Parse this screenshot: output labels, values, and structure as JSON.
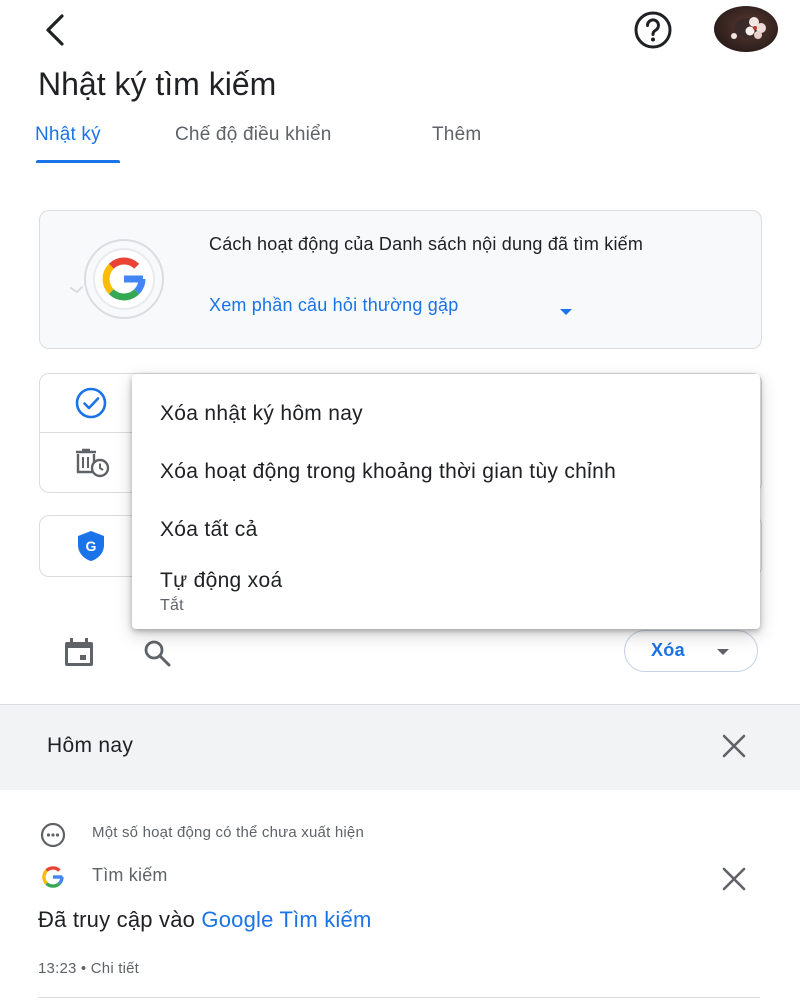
{
  "header": {
    "title": "Nhật ký tìm kiếm",
    "back_icon": "arrow-back-icon",
    "help_icon": "help-icon"
  },
  "tabs": [
    {
      "label": "Nhật ký",
      "active": true
    },
    {
      "label": "Chế độ điều khiển",
      "active": false
    },
    {
      "label": "Thêm",
      "active": false
    }
  ],
  "info_card": {
    "title": "Cách hoạt động của Danh sách nội dung đã tìm kiếm",
    "link": "Xem phần câu hỏi thường gặp"
  },
  "menu": {
    "items": [
      {
        "label": "Xóa nhật ký hôm nay"
      },
      {
        "label": "Xóa hoạt động trong khoảng thời gian tùy chỉnh"
      },
      {
        "label": "Xóa tất cả"
      },
      {
        "label": "Tự động xoá",
        "sublabel": "Tắt"
      }
    ]
  },
  "toolbar": {
    "delete_label": "Xóa"
  },
  "today": {
    "label": "Hôm nay",
    "notice": "Một số hoạt động có thể chưa xuất hiện",
    "item": {
      "source": "Tìm kiếm",
      "prefix": "Đã truy cập vào",
      "link": "Google Tìm kiếm",
      "time": "13:23",
      "separator": "•",
      "details": "Chi tiết"
    }
  },
  "colors": {
    "accent": "#1a73e8",
    "text": "#202124",
    "secondary": "#5f6368",
    "border": "#dadce0"
  }
}
